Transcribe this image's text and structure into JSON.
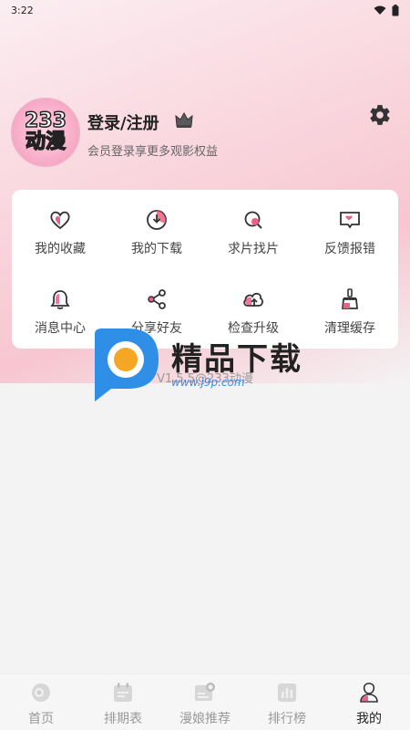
{
  "status_bar": {
    "time": "3:22"
  },
  "profile": {
    "avatar_line1": "233",
    "avatar_line2": "动漫",
    "title": "登录/注册",
    "subtitle": "会员登录享更多观影权益"
  },
  "menu": [
    {
      "label": "我的收藏",
      "icon": "heart-icon"
    },
    {
      "label": "我的下载",
      "icon": "download-icon"
    },
    {
      "label": "求片找片",
      "icon": "search-film-icon"
    },
    {
      "label": "反馈报错",
      "icon": "feedback-icon"
    },
    {
      "label": "消息中心",
      "icon": "bell-icon"
    },
    {
      "label": "分享好友",
      "icon": "share-icon"
    },
    {
      "label": "检查升级",
      "icon": "cloud-upload-icon"
    },
    {
      "label": "清理缓存",
      "icon": "broom-icon"
    }
  ],
  "version": "V1.5.5@233动漫",
  "watermark": {
    "title": "精品下载",
    "url": "www.j9p.com"
  },
  "tabs": [
    {
      "label": "首页",
      "icon": "home-icon",
      "active": false
    },
    {
      "label": "排期表",
      "icon": "calendar-icon",
      "active": false
    },
    {
      "label": "漫娘推荐",
      "icon": "recommend-icon",
      "active": false
    },
    {
      "label": "排行榜",
      "icon": "chart-icon",
      "active": false
    },
    {
      "label": "我的",
      "icon": "profile-icon",
      "active": true
    }
  ],
  "colors": {
    "accent": "#ee5f86",
    "page_bg": "#f4f3f4",
    "card_bg": "#ffffff"
  }
}
